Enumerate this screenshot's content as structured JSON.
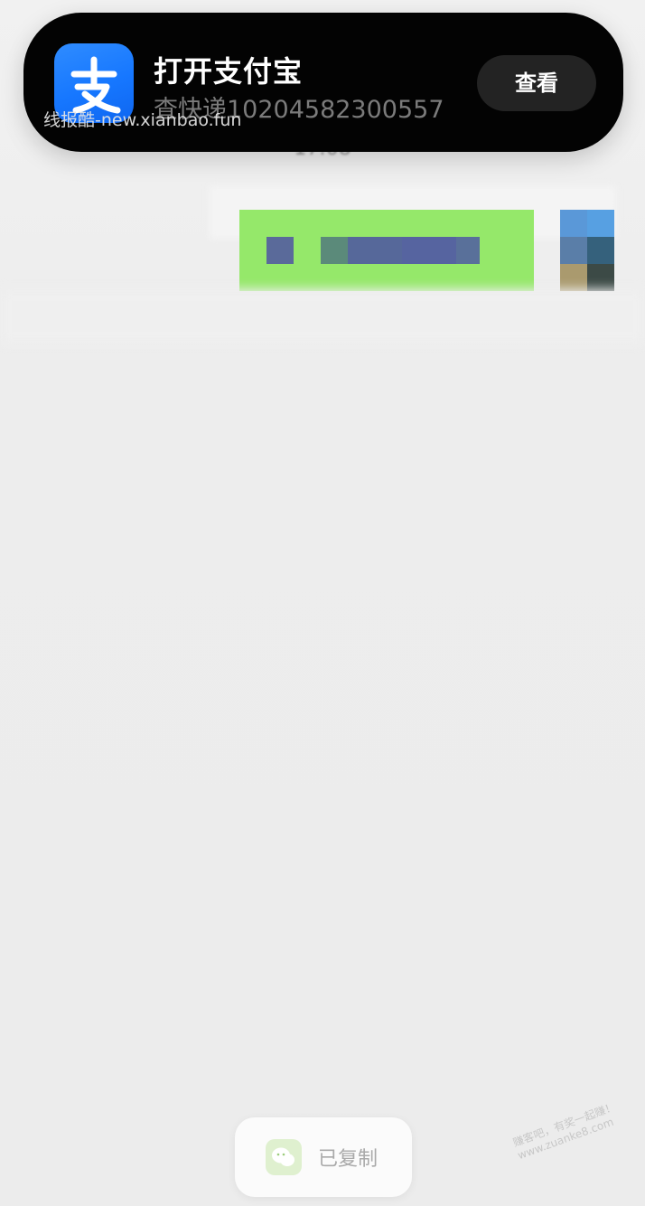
{
  "chat": {
    "time": "17:08"
  },
  "notification": {
    "app_icon": "alipay-icon",
    "title": "打开支付宝",
    "subtitle": "查快递10204582300557",
    "view_button_label": "查看"
  },
  "watermarks": {
    "top": "线报酷-new.xianbao.fun",
    "corner_line1": "赚客吧，有奖一起赚！",
    "corner_line2": "www.zuanke8.com"
  },
  "toast": {
    "icon": "wechat-icon",
    "text": "已复制"
  },
  "colors": {
    "banner_bg": "#030303",
    "alipay_blue": "#1677ff",
    "chat_bubble_green": "#95e86a",
    "page_bg": "#ececec"
  }
}
